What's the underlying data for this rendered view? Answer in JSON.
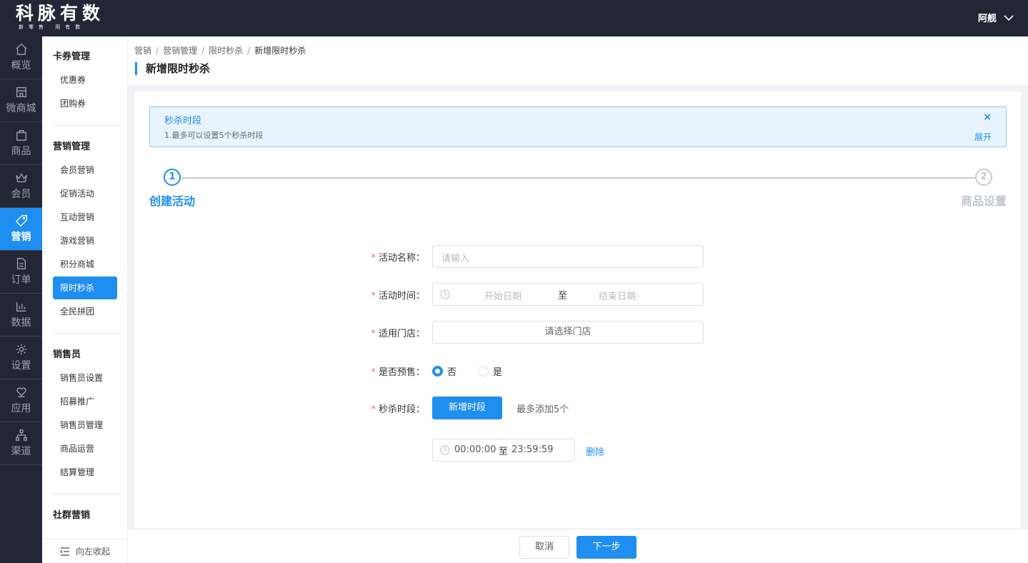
{
  "brand": {
    "name": "科脉有数",
    "slogan": "新零售 用有数"
  },
  "user": {
    "name": "阿舰"
  },
  "nav": [
    {
      "label": "概览",
      "icon": "home-icon"
    },
    {
      "label": "微商城",
      "icon": "store-icon"
    },
    {
      "label": "商品",
      "icon": "bag-icon"
    },
    {
      "label": "会员",
      "icon": "crown-icon"
    },
    {
      "label": "营销",
      "icon": "tag-icon",
      "active": true
    },
    {
      "label": "订单",
      "icon": "document-icon"
    },
    {
      "label": "数据",
      "icon": "chart-icon"
    },
    {
      "label": "设置",
      "icon": "gear-icon"
    },
    {
      "label": "应用",
      "icon": "heart-hand-icon"
    },
    {
      "label": "渠道",
      "icon": "network-icon"
    }
  ],
  "subnav": {
    "groups": [
      {
        "title": "卡券管理",
        "items": [
          "优惠券",
          "团购券"
        ]
      },
      {
        "title": "营销管理",
        "items": [
          "会员营销",
          "促销活动",
          "互动营销",
          "游戏营销",
          "积分商城",
          "限时秒杀",
          "全民拼团"
        ]
      },
      {
        "title": "销售员",
        "items": [
          "销售员设置",
          "招募推广",
          "销售员管理",
          "商品运营",
          "结算管理"
        ]
      },
      {
        "title": "社群营销",
        "items": []
      }
    ],
    "collapse_label": "向左收起"
  },
  "breadcrumb": [
    "营销",
    "营销管理",
    "限时秒杀",
    "新增限时秒杀"
  ],
  "page_title": "新增限时秒杀",
  "alert": {
    "title": "秒杀时段",
    "desc": "1.最多可以设置5个秒杀时段",
    "close": "×",
    "expand": "展开"
  },
  "steps": [
    {
      "num": "1",
      "label": "创建活动",
      "state": "active"
    },
    {
      "num": "2",
      "label": "商品设置",
      "state": "pending"
    }
  ],
  "form": {
    "name": {
      "label": "活动名称：",
      "placeholder": "请输入"
    },
    "time": {
      "label": "活动时间：",
      "start": "开始日期",
      "to": "至",
      "end": "结束日期"
    },
    "store": {
      "label": "适用门店：",
      "placeholder": "请选择门店"
    },
    "presale": {
      "label": "是否预售：",
      "options": [
        "否",
        "是"
      ],
      "selected": "否"
    },
    "slots": {
      "label": "秒杀时段：",
      "add_button": "新增时段",
      "hint": "最多添加5个"
    },
    "slot_row": {
      "start": "00:00:00",
      "to": "至",
      "end": "23:59:59",
      "delete": "删除"
    }
  },
  "footer": {
    "cancel": "取消",
    "next": "下一步"
  },
  "colors": {
    "accent": "#1f8ef1",
    "sidebar": "#232634",
    "required": "#f56c6c"
  }
}
